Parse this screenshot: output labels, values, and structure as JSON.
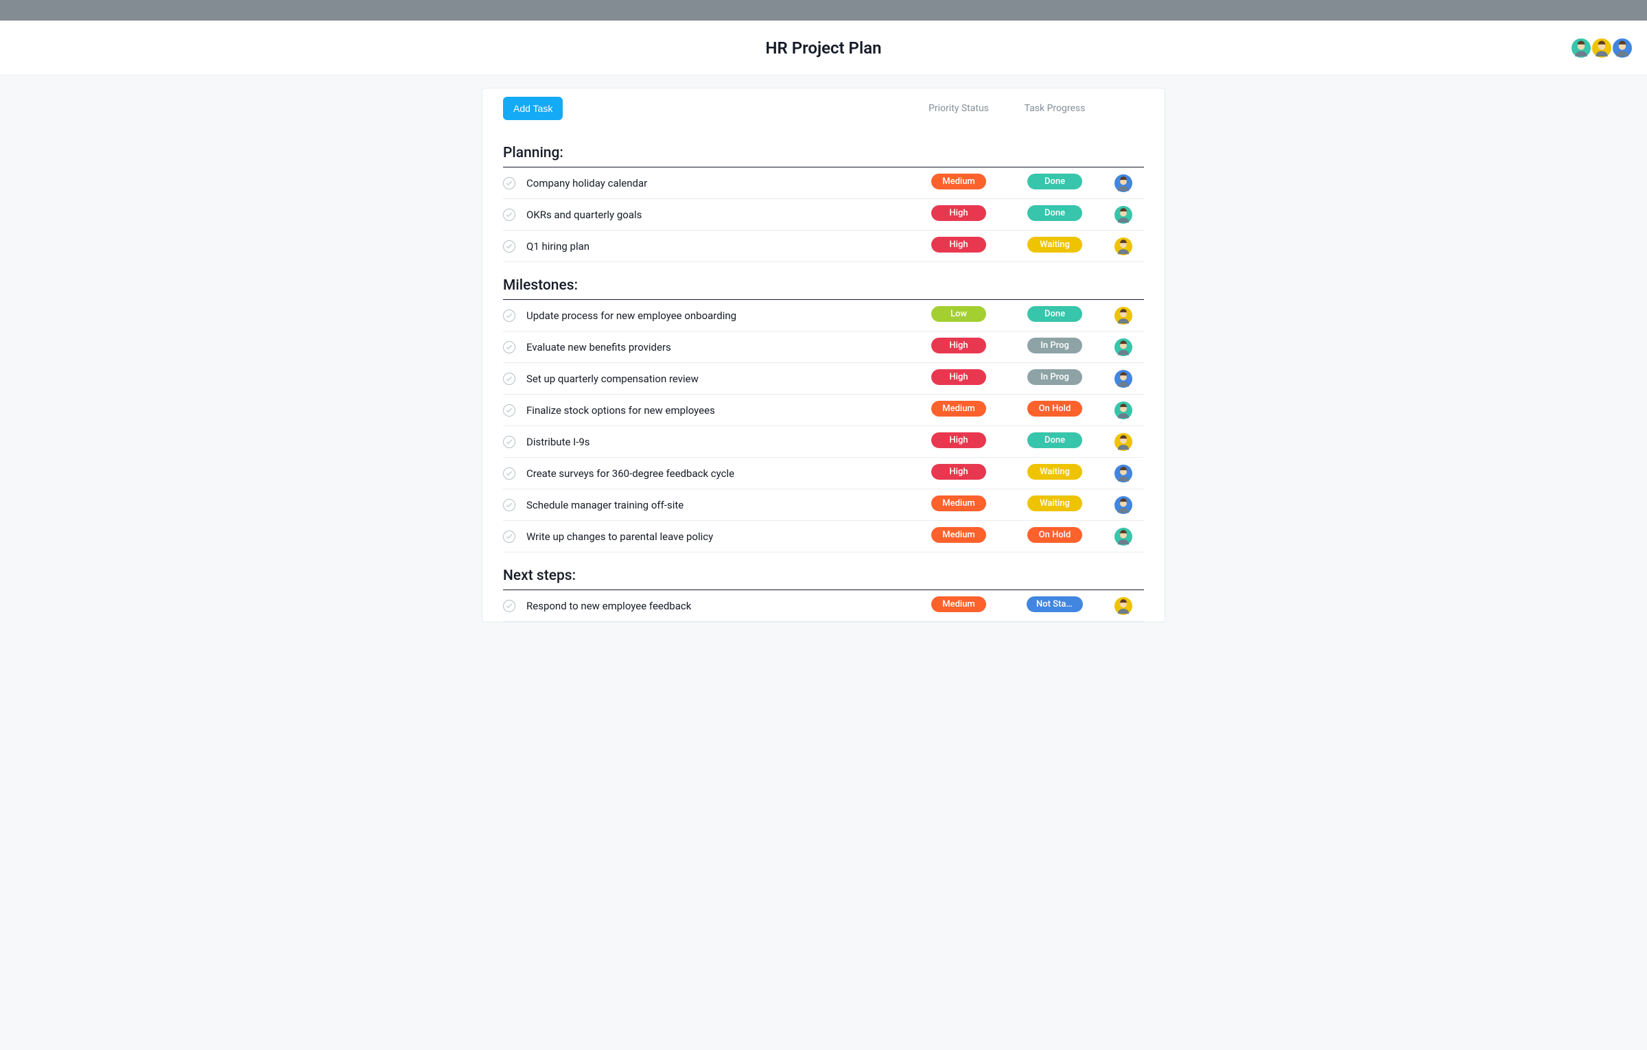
{
  "title": "HR Project Plan",
  "toolbar": {
    "add_task": "Add Task",
    "columns": {
      "priority": "Priority Status",
      "progress": "Task Progress"
    }
  },
  "header_avatars": [
    {
      "color": "av-green"
    },
    {
      "color": "av-yellow"
    },
    {
      "color": "av-blue"
    }
  ],
  "pill_colors": {
    "Medium": "p-medium",
    "High": "p-high",
    "Low": "p-low",
    "Done": "s-done",
    "Waiting": "s-waiting",
    "In Prog": "s-inprog",
    "On Hold": "s-onhold",
    "Not Star...": "s-notstar"
  },
  "sections": [
    {
      "title": "Planning:",
      "tasks": [
        {
          "name": "Company holiday calendar",
          "priority": "Medium",
          "progress": "Done",
          "assignee_color": "av-blue"
        },
        {
          "name": "OKRs and quarterly goals",
          "priority": "High",
          "progress": "Done",
          "assignee_color": "av-green"
        },
        {
          "name": "Q1 hiring plan",
          "priority": "High",
          "progress": "Waiting",
          "assignee_color": "av-yellow"
        }
      ]
    },
    {
      "title": "Milestones:",
      "tasks": [
        {
          "name": "Update process for new employee onboarding",
          "priority": "Low",
          "progress": "Done",
          "assignee_color": "av-yellow"
        },
        {
          "name": "Evaluate new benefits providers",
          "priority": "High",
          "progress": "In Prog",
          "assignee_color": "av-green"
        },
        {
          "name": "Set up quarterly compensation review",
          "priority": "High",
          "progress": "In Prog",
          "assignee_color": "av-blue"
        },
        {
          "name": "Finalize stock options for new employees",
          "priority": "Medium",
          "progress": "On Hold",
          "assignee_color": "av-green"
        },
        {
          "name": "Distribute I-9s",
          "priority": "High",
          "progress": "Done",
          "assignee_color": "av-yellow"
        },
        {
          "name": "Create surveys for 360-degree feedback cycle",
          "priority": "High",
          "progress": "Waiting",
          "assignee_color": "av-blue"
        },
        {
          "name": "Schedule manager training off-site",
          "priority": "Medium",
          "progress": "Waiting",
          "assignee_color": "av-blue"
        },
        {
          "name": "Write up changes to parental leave policy",
          "priority": "Medium",
          "progress": "On Hold",
          "assignee_color": "av-green"
        }
      ]
    },
    {
      "title": "Next steps:",
      "tasks": [
        {
          "name": "Respond to new employee feedback",
          "priority": "Medium",
          "progress": "Not Star...",
          "assignee_color": "av-yellow"
        }
      ]
    }
  ]
}
